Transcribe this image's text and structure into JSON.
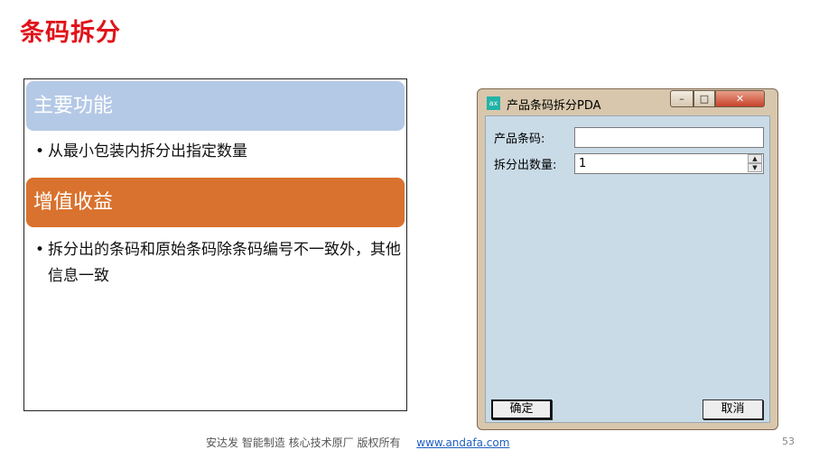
{
  "slide": {
    "title": "条码拆分",
    "sections": [
      {
        "heading": "主要功能",
        "bullets": [
          "从最小包装内拆分出指定数量"
        ]
      },
      {
        "heading": "增值收益",
        "bullets": [
          "拆分出的条码和原始条码除条码编号不一致外，其他信息一致"
        ]
      }
    ],
    "bullet_symbol": "•"
  },
  "window": {
    "title": "产品条码拆分PDA",
    "app_icon_text": "ax",
    "controls": {
      "minimize": "–",
      "maximize": "□",
      "close": "✕"
    },
    "fields": {
      "barcode_label": "产品条码:",
      "barcode_value": "",
      "quantity_label": "拆分出数量:",
      "quantity_value": "1"
    },
    "spin_up": "▲",
    "spin_down": "▼",
    "buttons": {
      "ok": "确定",
      "cancel": "取消"
    }
  },
  "footer": {
    "text": "安达发   智能制造 核心技术原厂    版权所有",
    "link": "www.andafa.com",
    "page_number": "53"
  }
}
